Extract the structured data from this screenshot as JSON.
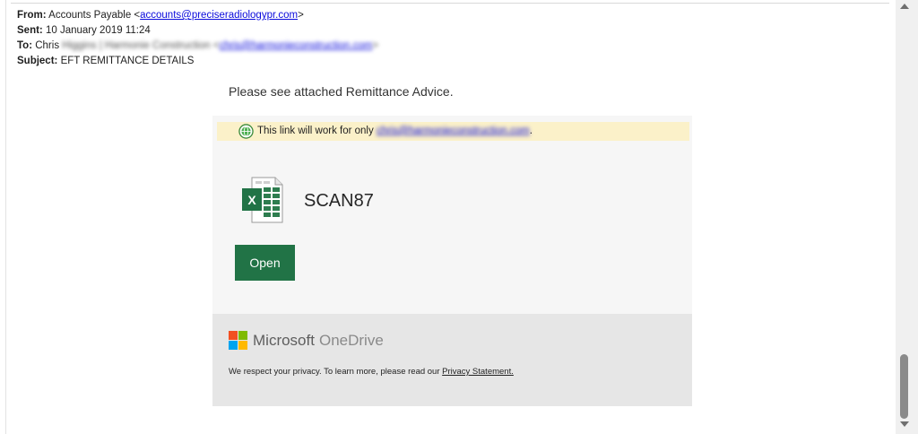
{
  "email": {
    "from_label": "From:",
    "from_name": "Accounts Payable <",
    "from_email": "accounts@preciseradiologypr.com",
    "from_close": ">",
    "sent_label": "Sent:",
    "sent_value": "10 January 2019 11:24",
    "to_label": "To:",
    "to_first": "Chris",
    "to_blurred": "Higgins | Harmonie Construction <",
    "to_email": "chris@harmonieconstruction.com",
    "to_close": ">",
    "subject_label": "Subject:",
    "subject_value": "EFT REMITTANCE DETAILS"
  },
  "body": {
    "intro": "Please see attached Remittance Advice.",
    "notice_text": "This link will work for only ",
    "notice_email": "chris@harmonieconstruction.com",
    "notice_end": ".",
    "file_name": "SCAN87",
    "open_label": "Open"
  },
  "footer": {
    "brand_microsoft": "Microsoft",
    "brand_onedrive": "OneDrive",
    "privacy_text": "We respect your privacy. To learn more, please read our ",
    "privacy_link": "Privacy Statement."
  },
  "colors": {
    "excel_green": "#217346",
    "ms_red": "#f25022",
    "ms_green": "#7fba00",
    "ms_blue": "#00a4ef",
    "ms_yellow": "#ffb900",
    "notice_bg": "#fbf1c9",
    "link_blue": "#0a0adc"
  },
  "icons": {
    "globe": "globe-icon",
    "excel": "excel-file-icon",
    "microsoft": "microsoft-logo-icon"
  }
}
